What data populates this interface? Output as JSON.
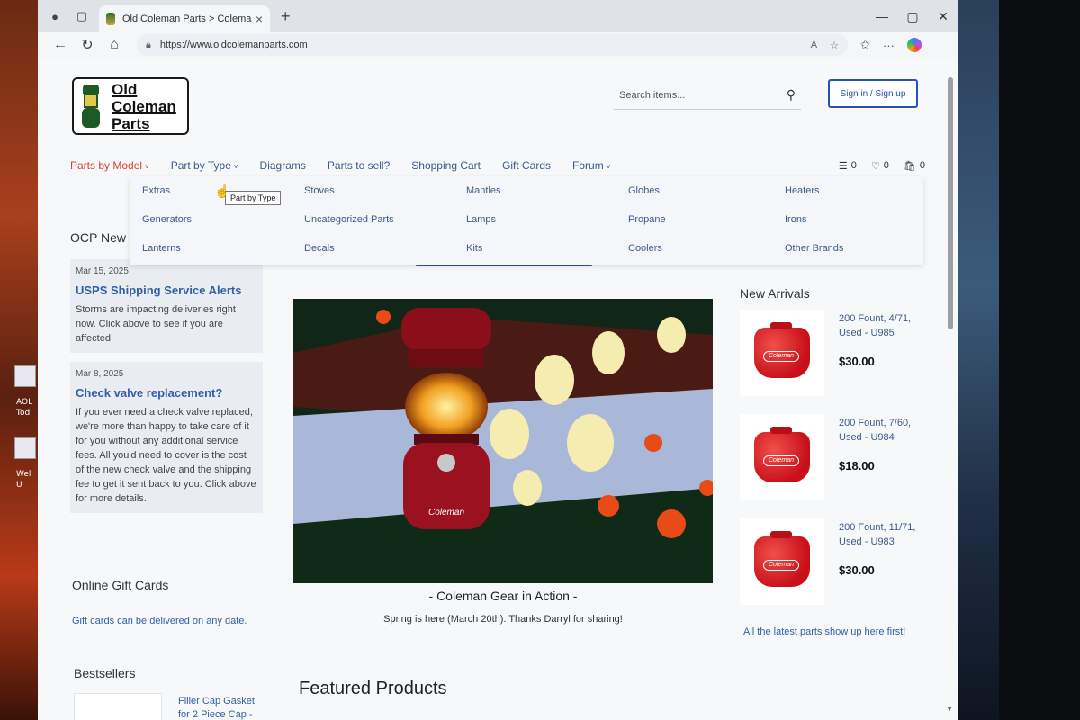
{
  "browser": {
    "tab_title": "Old Coleman Parts > Coleman Pa",
    "url": "https://www.oldcolemanparts.com",
    "read_aloud": "Ȧ",
    "new_tab": "+"
  },
  "header": {
    "logo_lines": [
      "Old",
      "Coleman",
      "Parts"
    ],
    "search_placeholder": "Search items...",
    "signin_label": "Sign in / Sign up"
  },
  "nav": {
    "items": [
      {
        "label": "Parts by Model",
        "chevron": "˅"
      },
      {
        "label": "Part by Type",
        "chevron": "˅"
      },
      {
        "label": "Diagrams"
      },
      {
        "label": "Parts to sell?"
      },
      {
        "label": "Shopping Cart"
      },
      {
        "label": "Gift Cards"
      },
      {
        "label": "Forum",
        "chevron": "˅"
      }
    ],
    "cart_count": "0",
    "wishlist_count": "0",
    "bag_count": "0",
    "active_color": "#d2442e"
  },
  "mega_menu": {
    "columns": [
      [
        "Extras",
        "Generators",
        "Lanterns"
      ],
      [
        "Stoves",
        "Uncategorized Parts",
        "Decals"
      ],
      [
        "Mantles",
        "Lamps",
        "Kits"
      ],
      [
        "Globes",
        "Propane",
        "Coolers"
      ],
      [
        "Heaters",
        "Irons",
        "Other Brands"
      ]
    ],
    "tooltip": "Part by Type"
  },
  "news": {
    "section_title": "OCP New",
    "items": [
      {
        "date": "Mar 15, 2025",
        "title": "USPS Shipping Service Alerts",
        "body": "Storms are impacting deliveries right now. Click above to see if you are affected."
      },
      {
        "date": "Mar 8, 2025",
        "title": "Check valve replacement?",
        "body": "If you ever need a check valve replaced, we're more than happy to take care of it for you without any additional service fees. All you'd need to cover is the cost of the new check valve and the shipping fee to get it sent back to you. Click above for more details."
      }
    ]
  },
  "gift": {
    "title": "Online Gift Cards",
    "link": "Gift cards can be delivered on any date."
  },
  "bestsellers": {
    "title": "Bestsellers",
    "first_item": "Filler Cap Gasket for 2 Piece Cap -"
  },
  "hero": {
    "caption": "- Coleman Gear in Action -",
    "subcaption": "Spring is here (March 20th). Thanks Darryl for sharing!",
    "lantern_brand": "Coleman"
  },
  "featured_title": "Featured Products",
  "arrivals": {
    "title": "New Arrivals",
    "items": [
      {
        "name": "200 Fount, 4/71, Used - U985",
        "price": "$30.00"
      },
      {
        "name": "200 Fount, 7/60, Used - U984",
        "price": "$18.00"
      },
      {
        "name": "200 Fount, 11/71, Used - U983",
        "price": "$30.00"
      }
    ],
    "tank_label": "Coleman",
    "link": "All the latest parts show up here first!"
  },
  "desktop": {
    "labels": [
      "AOL",
      "Tod",
      "Wel",
      "U"
    ]
  }
}
